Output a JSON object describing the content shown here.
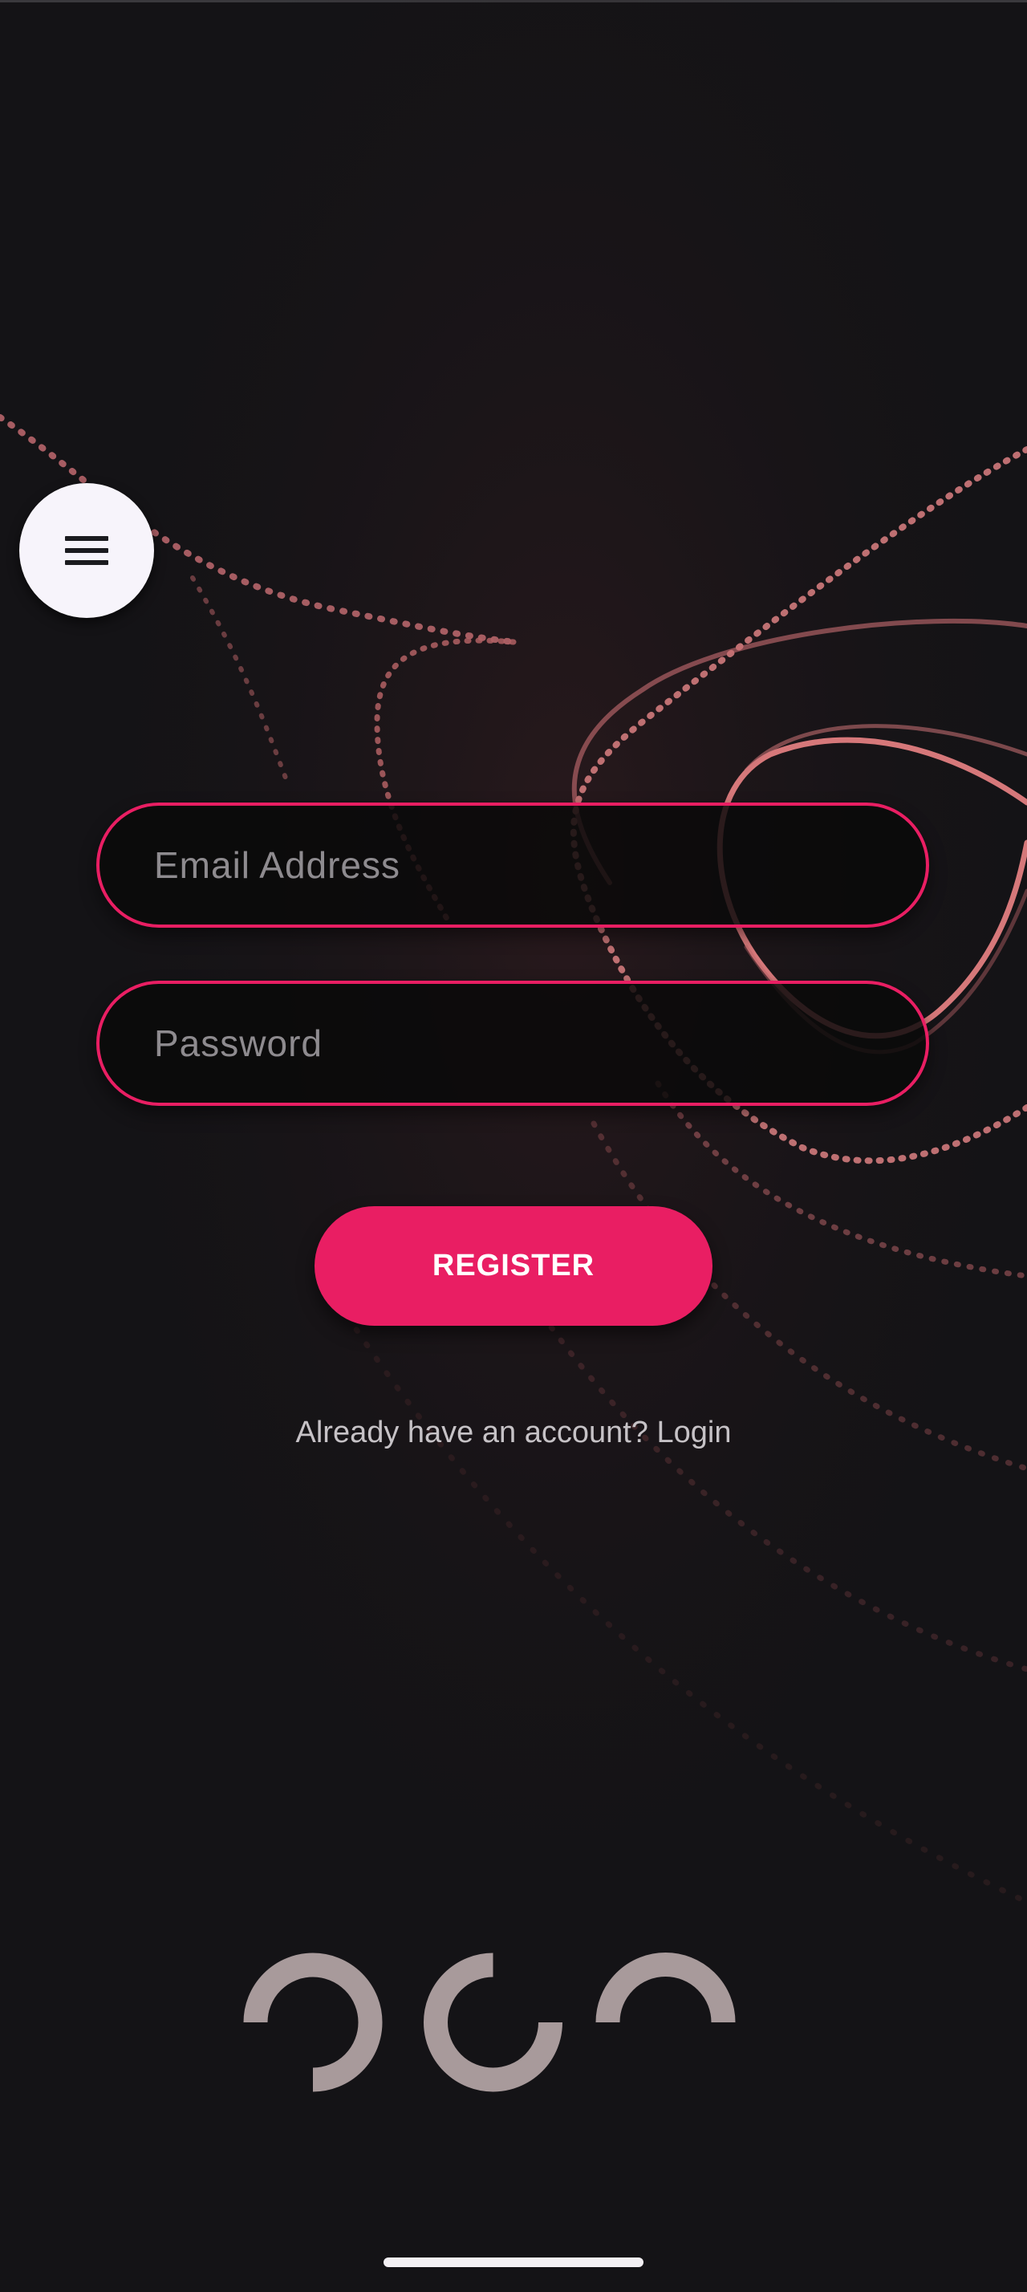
{
  "menu": {
    "icon": "hamburger-menu-icon"
  },
  "form": {
    "email_placeholder": "Email Address",
    "password_placeholder": "Password",
    "register_label": "REGISTER",
    "login_prompt": "Already have an account? Login"
  },
  "loader": {
    "icon": "loading-spinner-icon",
    "dots": 3
  },
  "colors": {
    "accent": "#e91e63",
    "background": "#141316",
    "menu_button": "#f7f4fb",
    "loader": "#a89a9b"
  }
}
